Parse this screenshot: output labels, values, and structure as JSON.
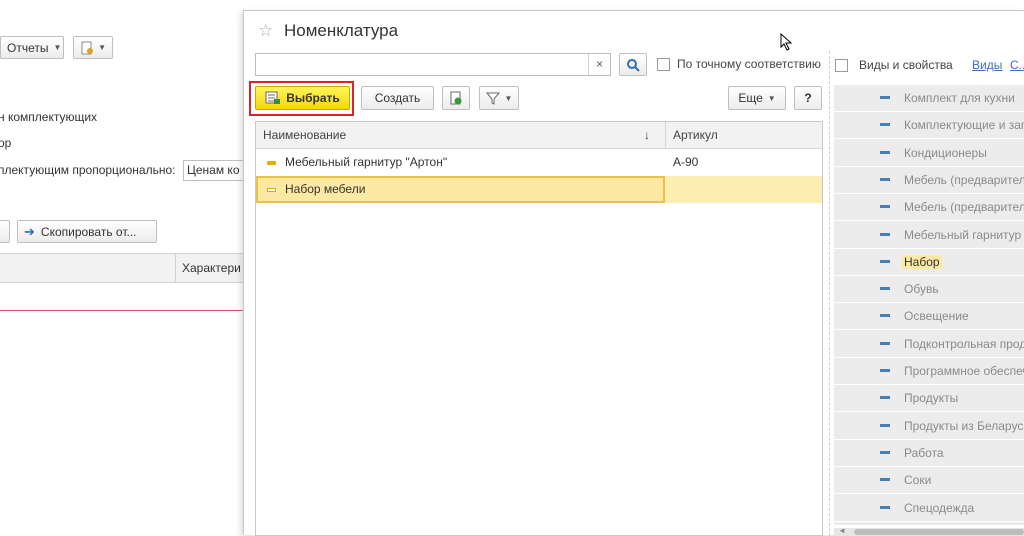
{
  "background_form": {
    "reports_button": "Отчеты",
    "line1": "н комплектующих",
    "line2": "ор",
    "line3": "плектующим пропорционально:",
    "select_value": "Ценам ко",
    "copy_button": "Скопировать от...",
    "column_header": "Характери"
  },
  "window": {
    "title": "Номенклатура",
    "search": {
      "value": "",
      "placeholder": ""
    },
    "exact_match_label": "По точному соответствию",
    "toolbar": {
      "select_button": "Выбрать",
      "create_button": "Создать",
      "more_button": "Еще",
      "help_button": "?"
    },
    "table": {
      "columns": [
        "Наименование",
        "Артикул"
      ],
      "sort_indicator": "↓",
      "rows": [
        {
          "name": "Мебельный гарнитур \"Артон\"",
          "article": "А-90",
          "selected": false
        },
        {
          "name": "Набор мебели",
          "article": "",
          "selected": true
        }
      ]
    },
    "right_panel": {
      "checkbox_label": "Виды и свойства",
      "link1": "Виды",
      "link2": "С...",
      "items": [
        "Комплект для кухни",
        "Комплектующие и зап",
        "Кондиционеры",
        "Мебель (предварител",
        "Мебель (предварител",
        "Мебельный гарнитур (",
        "Набор",
        "Обувь",
        "Освещение",
        "Подконтрольная прод",
        "Программное обеспеч",
        "Продукты",
        "Продукты из Беларус",
        "Работа",
        "Соки",
        "Спецодежда"
      ],
      "active_index": 6
    }
  }
}
